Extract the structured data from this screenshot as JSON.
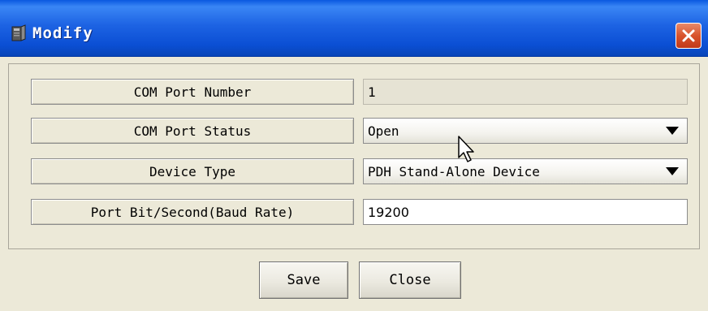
{
  "window": {
    "title": "Modify"
  },
  "form": {
    "rows": [
      {
        "label": "COM Port Number",
        "value": "1",
        "kind": "readonly"
      },
      {
        "label": "COM Port Status",
        "value": "Open",
        "kind": "dropdown"
      },
      {
        "label": "Device Type",
        "value": "PDH Stand-Alone Device",
        "kind": "dropdown"
      },
      {
        "label": "Port Bit/Second(Baud Rate)",
        "value": "19200",
        "kind": "text-input"
      }
    ]
  },
  "buttons": {
    "save_label": "Save",
    "close_label": "Close"
  },
  "colors": {
    "titlebar": "#0b4fd4",
    "close_button": "#d9532c",
    "dialog_bg": "#ece9d8"
  },
  "icons": {
    "window_icon": "device-icon",
    "close": "close-icon",
    "dropdown": "chevron-down-icon",
    "pointer": "mouse-cursor-icon"
  }
}
